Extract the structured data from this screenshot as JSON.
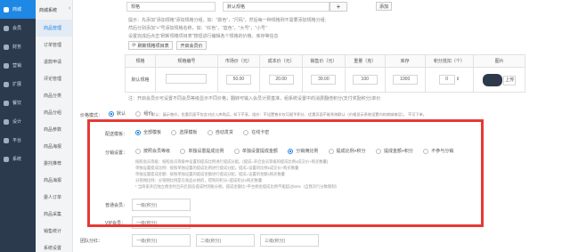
{
  "nav1": {
    "items": [
      {
        "label": "商城",
        "active": true
      },
      {
        "label": "会员",
        "active": false
      },
      {
        "label": "财务",
        "active": false
      },
      {
        "label": "营销",
        "active": false
      },
      {
        "label": "扩展",
        "active": false
      },
      {
        "label": "餐饮",
        "active": false
      },
      {
        "label": "设计",
        "active": false
      },
      {
        "label": "平台",
        "active": false
      },
      {
        "label": "系统",
        "active": false
      }
    ]
  },
  "nav2": {
    "header": "商城系统",
    "items": [
      "商品管理",
      "订单管理",
      "退款申请",
      "评论管理",
      "商品分类",
      "商品分组",
      "商品参数",
      "商品海报",
      "委托推荐",
      "商品海报",
      "委人订单",
      "商品采集",
      "销售统计",
      "系统设置"
    ]
  },
  "spec": {
    "input1": "规格",
    "input2": "默认规格",
    "plus": "+",
    "add": "添加",
    "hint1": "提示：先添加\"添加规格\"添加规格分组，如：\"颜色\"，\"尺码\"，然后每一种规格例不需要添加规格分组;",
    "hint2": "然后分别添加\"+\"号添加规格名称，如：\"红色\"，\"蓝色\"，\"大号\"，\"小号\"",
    "hint3": "设置完成后点击\"刷新规格项目表\"按钮进行编辑各个规格的价格、库存等信息",
    "refresh_btn": "刷新规格项目表",
    "points_btn": "开启会员价"
  },
  "table": {
    "headers": [
      "规格",
      "规格编号",
      "市场价（元）",
      "成本价（元）",
      "销售价（元）",
      "重量（克）",
      "库存",
      "积分抵扣（个）",
      "图片"
    ],
    "row": {
      "name": "默认规格",
      "market": "50.00",
      "cost": "20.00",
      "sale": "39.00",
      "weight": "100",
      "stock": "1000",
      "points": "0",
      "upload": "上传"
    }
  },
  "note_after_table": "注：开启会员价可设置不同会员等级显示不同价格；翻转可输入会员计费基准，组系统设置中的消费翻倍积分(支付奖励积分)单价",
  "price_mode": {
    "label": "价格模式：",
    "opt1": "默认",
    "opt2": "组价",
    "hint": "默认：展示售价，优惠页面不包含对应入库购买。如下不享，组价：不设置售价仅可赋予积分，优惠页面不能系统默认（价格显示系统设置内的商城电话）。 不可下单。"
  },
  "delivery": {
    "label": "配送模板：",
    "options": [
      "全部模板",
      "选择模板",
      "自动发货",
      "在线卡密"
    ],
    "selected": 0
  },
  "distribution": {
    "label": "分销设置：",
    "options": [
      "按照会员等级",
      "单独设置提成比例",
      "单独设置提成金额",
      "分销佣比例",
      "提成比例+积分",
      "提成金额+积分",
      "不参与分销"
    ],
    "selected": 3,
    "notes": [
      "按照会员等级：按照会员等级中设置的提成比例进行提成分配。(提成=开启会员等级的提成比例x成交价+购买数量)",
      "单独设置提成比例：按照单独设置的提成比例进行提成分配。提成=设置的比例x成交价+购买数量",
      "单独设置提成金额：按照单独设置的提成金额进行提成分配。提成=设置的金额x购买数量",
      "分销佣比例：分销佣比例是在商品价格的，得到的积分=提成积分x购买数量",
      "* 当商家开启独立佣金时且开启固态提成时到账分佣。提成金额比+平台佣金提成比例不能超过50%（自我次行分数限制）"
    ]
  },
  "member": {
    "label": "普通会员：",
    "placeholder": "一级(积分)"
  },
  "vip": {
    "label": "VIP会员：",
    "placeholder": "一级(积分)"
  },
  "team": {
    "label": "团队分红：",
    "p1": "一级(积分)",
    "p2": "二级(积分)",
    "p3": "三级(积分)"
  }
}
